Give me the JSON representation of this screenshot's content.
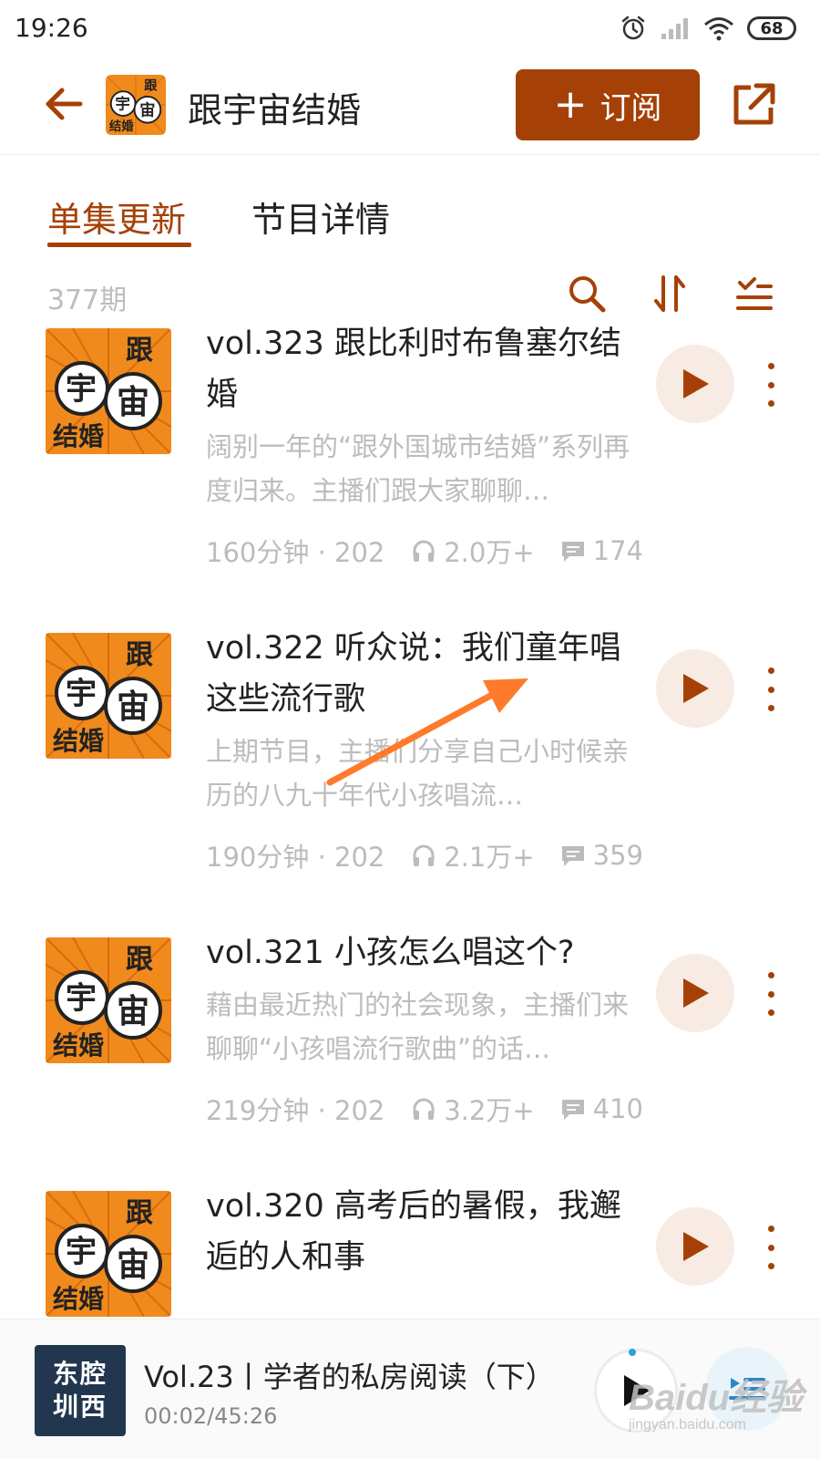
{
  "status_bar": {
    "time": "19:26",
    "battery": "68"
  },
  "header": {
    "title": "跟宇宙结婚",
    "subscribe_plus": "+",
    "subscribe_label": "订阅"
  },
  "tabs": [
    {
      "label": "单集更新",
      "active": true
    },
    {
      "label": "节目详情",
      "active": false
    }
  ],
  "toolbar": {
    "episode_count": "377期"
  },
  "cover_art": {
    "line1": "跟",
    "char_a": "宇",
    "char_b": "宙",
    "line3": "结婚"
  },
  "episodes": [
    {
      "title": "vol.323 跟比利时布鲁塞尔结婚",
      "desc": "阔别一年的“跟外国城市结婚”系列再度归来。主播们跟大家聊聊…",
      "duration": "160分钟 · 202…",
      "plays": "2.0万+",
      "comments": "174"
    },
    {
      "title": "vol.322 听众说：我们童年唱这些流行歌",
      "desc": "上期节目，主播们分享自己小时候亲历的八九十年代小孩唱流…",
      "duration": "190分钟 · 202…",
      "plays": "2.1万+",
      "comments": "359"
    },
    {
      "title": "vol.321 小孩怎么唱这个?",
      "desc": "藉由最近热门的社会现象，主播们来聊聊“小孩唱流行歌曲”的话…",
      "duration": "219分钟 · 202…",
      "plays": "3.2万+",
      "comments": "410"
    },
    {
      "title": "vol.320 高考后的暑假，我邂逅的人和事",
      "desc": "",
      "duration": "",
      "plays": "",
      "comments": ""
    }
  ],
  "mini_player": {
    "cover_line1": "东腔",
    "cover_line2": "圳西",
    "title": "Vol.23丨学者的私房阅读（下）",
    "time": "00:02/45:26"
  },
  "colors": {
    "accent": "#a54106",
    "cover_orange": "#f08a1c",
    "play_bg": "#f7ebe3",
    "annotation_arrow": "#ff7a2a"
  },
  "watermark": {
    "main": "Baidu经验",
    "sub": "jingyan.baidu.com"
  }
}
